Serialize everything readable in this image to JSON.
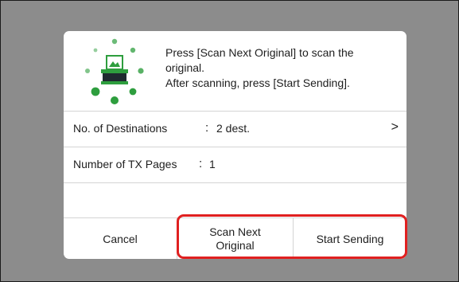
{
  "dialog": {
    "message_lines": [
      "Press [Scan Next Original] to scan the",
      "original.",
      "After scanning, press [Start Sending]."
    ],
    "icon": "scanner-progress-icon",
    "accent_color": "#2e9e3e",
    "rows": [
      {
        "label": "No. of Destinations",
        "separator": ":",
        "value": "2 dest.",
        "chevron": ">"
      },
      {
        "label": "Number of TX Pages",
        "separator": ":",
        "value": "1"
      }
    ],
    "buttons": {
      "cancel": "Cancel",
      "scan_next": "Scan Next Original",
      "start_sending": "Start Sending"
    },
    "highlight_color": "#e02020"
  }
}
